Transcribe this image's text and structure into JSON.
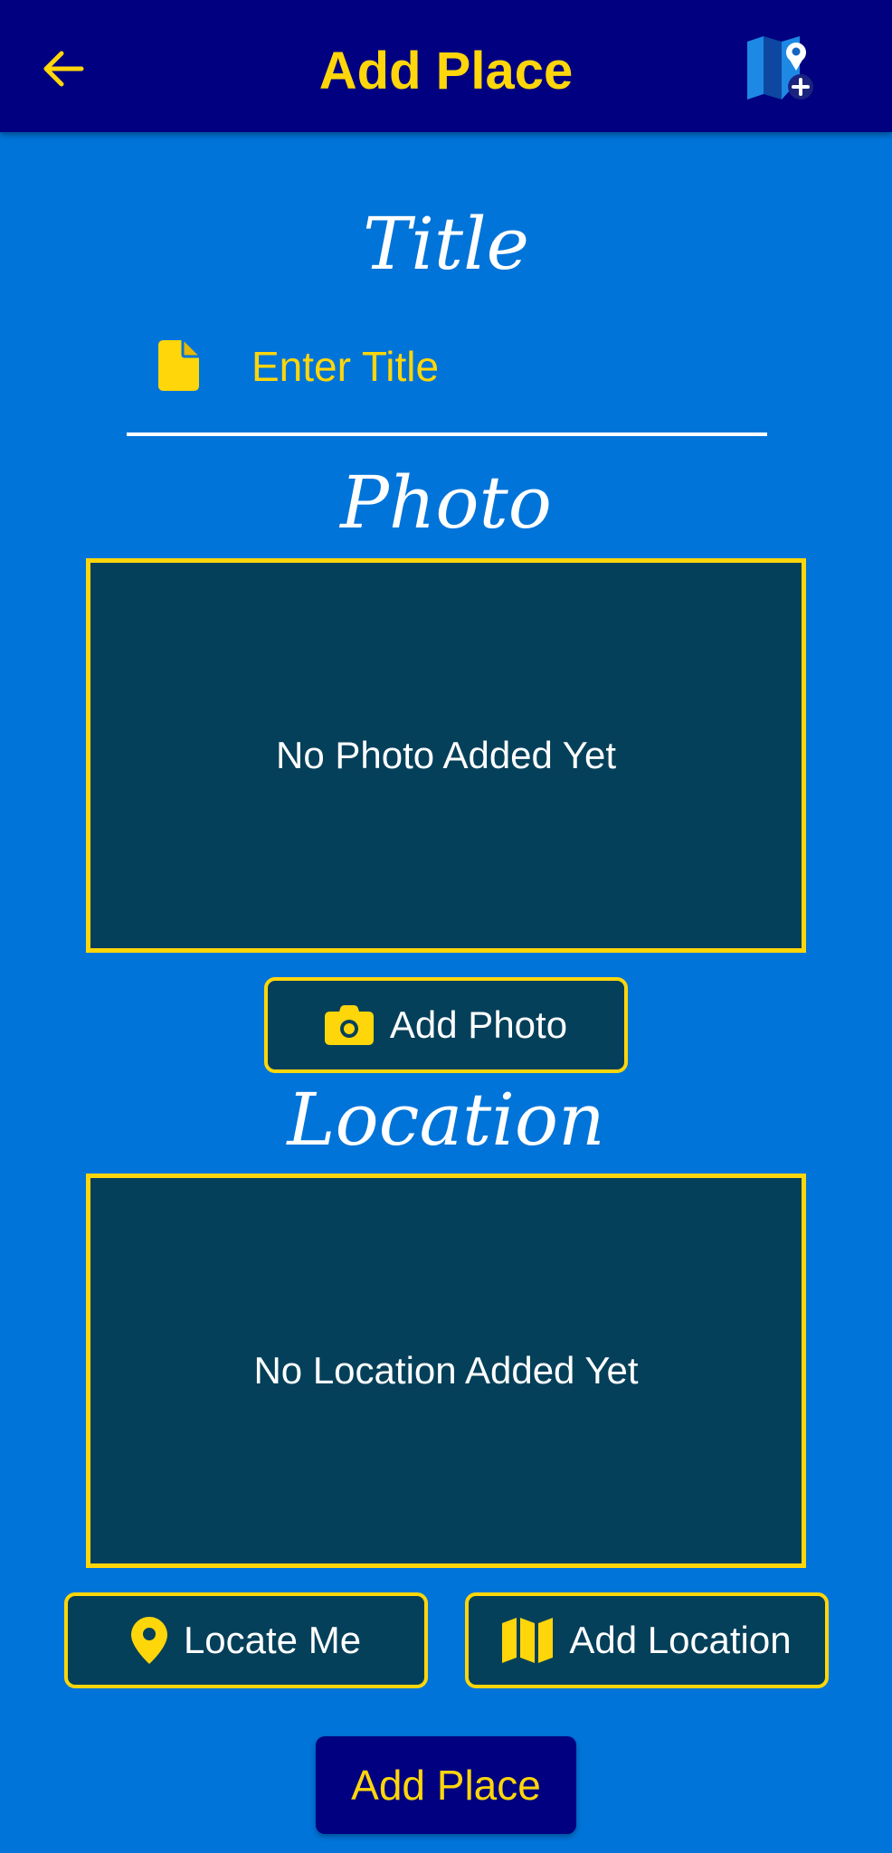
{
  "appbar": {
    "title": "Add Place",
    "back_icon": "arrow-left-icon",
    "action_icon": "map-add-location-icon"
  },
  "title_section": {
    "label": "Title",
    "placeholder": "Enter Title",
    "value": "",
    "icon": "document-icon"
  },
  "photo_section": {
    "label": "Photo",
    "empty_text": "No Photo Added Yet",
    "button_label": "Add Photo",
    "button_icon": "camera-icon"
  },
  "location_section": {
    "label": "Location",
    "empty_text": "No Location Added Yet",
    "locate_button_label": "Locate Me",
    "locate_button_icon": "location-pin-icon",
    "add_button_label": "Add Location",
    "add_button_icon": "map-icon"
  },
  "submit": {
    "label": "Add Place"
  },
  "colors": {
    "background": "#0074d9",
    "appbar": "#000080",
    "accent": "#ffd60a",
    "panel": "#05405a",
    "text": "#ffffff"
  }
}
